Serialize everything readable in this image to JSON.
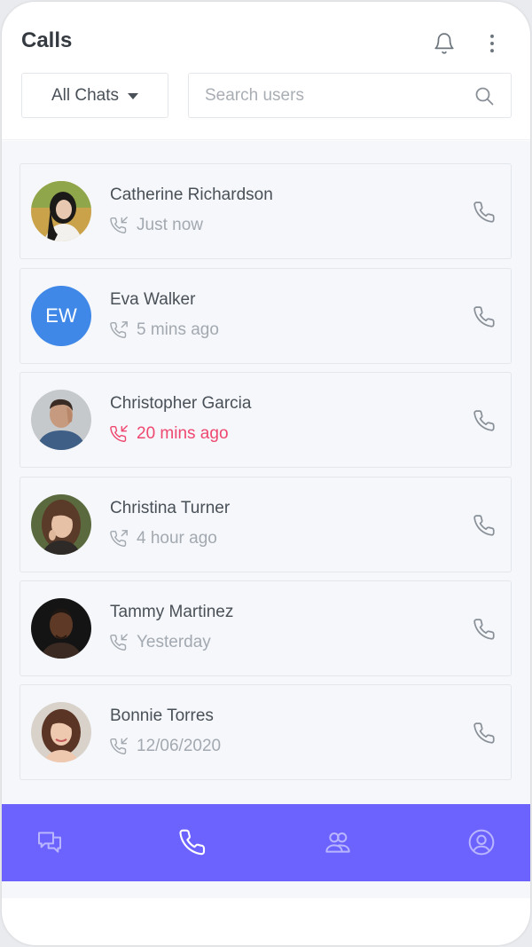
{
  "header": {
    "title": "Calls",
    "filter_label": "All Chats",
    "search_placeholder": "Search users",
    "icons": [
      "bell-icon",
      "more-vertical-icon",
      "search-icon"
    ]
  },
  "calls": [
    {
      "name": "Catherine Richardson",
      "time": "Just now",
      "status": "incoming",
      "avatar": "photo"
    },
    {
      "name": "Eva Walker",
      "time": "5 mins ago",
      "status": "outgoing",
      "avatar": "initials",
      "initials": "EW"
    },
    {
      "name": "Christopher Garcia",
      "time": "20 mins ago",
      "status": "missed",
      "avatar": "photo"
    },
    {
      "name": "Christina Turner",
      "time": "4 hour ago",
      "status": "outgoing",
      "avatar": "photo"
    },
    {
      "name": "Tammy Martinez",
      "time": "Yesterday",
      "status": "incoming",
      "avatar": "photo"
    },
    {
      "name": "Bonnie Torres",
      "time": "12/06/2020",
      "status": "incoming",
      "avatar": "photo"
    }
  ],
  "bottom_nav": {
    "items": [
      "chats-icon",
      "phone-icon",
      "contacts-icon",
      "profile-icon"
    ],
    "active": "phone-icon"
  },
  "colors": {
    "accent": "#6c63ff",
    "missed": "#ef476f",
    "avatar_initials_bg": "#3f88e8",
    "list_bg": "#f5f7fb"
  }
}
